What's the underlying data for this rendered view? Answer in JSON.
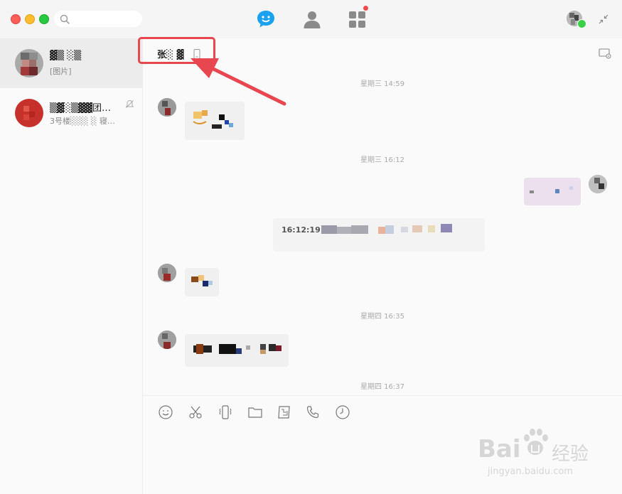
{
  "search": {
    "placeholder": ""
  },
  "conversations": [
    {
      "name": "▓▒ ░▒",
      "preview": "[图片]",
      "active": true
    },
    {
      "name": "▒▓░▒▓▓团…",
      "preview": "3号楼░░░ ░ 寝…",
      "active": false
    }
  ],
  "chat": {
    "title": "张░ ▓",
    "timestamps": [
      "星期三  14:59",
      "星期三  16:12",
      "星期四  16:35",
      "星期四  16:37"
    ],
    "system_message_time": "16:12:19"
  },
  "toolbar": {
    "tools": [
      "emoji-icon",
      "scissors-icon",
      "vibrate-icon",
      "folder-icon",
      "picture-icon",
      "phone-icon",
      "history-icon"
    ]
  },
  "watermark": {
    "brand": "Bai",
    "brand2": "经验",
    "url": "jingyan.baidu.com"
  },
  "colors": {
    "accent": "#1aa1f0",
    "highlight": "#e8474f",
    "online": "#3ad047"
  }
}
